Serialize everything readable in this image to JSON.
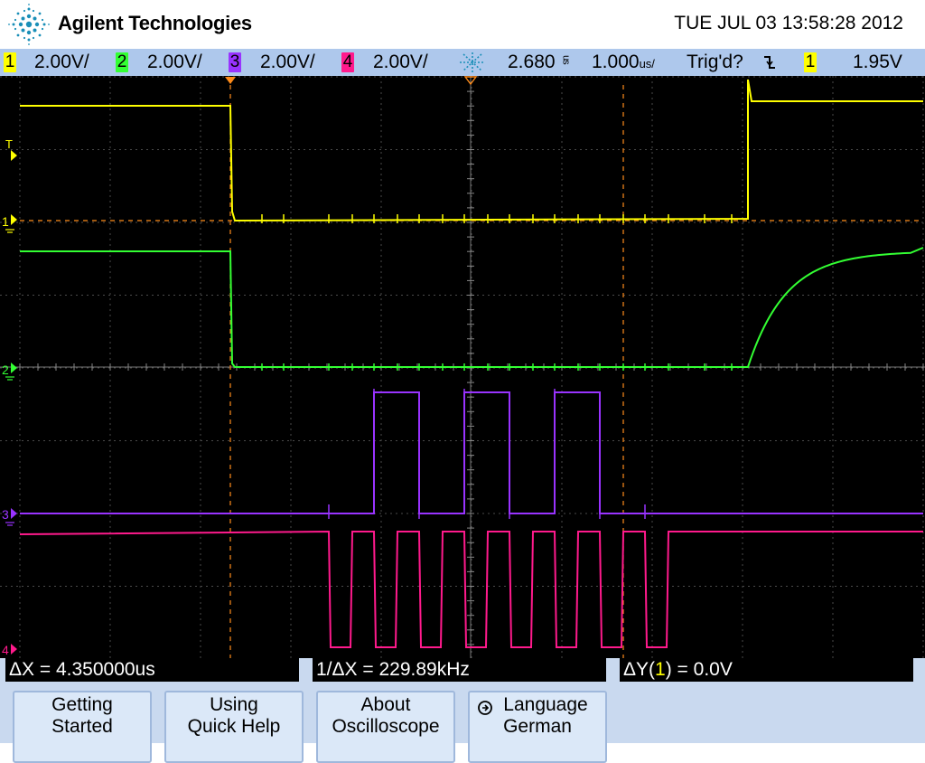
{
  "header": {
    "brand": "Agilent Technologies",
    "datetime": "TUE JUL 03 13:58:28 2012"
  },
  "status": {
    "channels": [
      {
        "num": "1",
        "scale": "2.00V/",
        "color": "#ffff00"
      },
      {
        "num": "2",
        "scale": "2.00V/",
        "color": "#33ff33"
      },
      {
        "num": "3",
        "scale": "2.00V/",
        "color": "#9933ff"
      },
      {
        "num": "4",
        "scale": "2.00V/",
        "color": "#ff1a8c"
      }
    ],
    "time_position": "2.680",
    "time_position_unit": "us",
    "time_scale": "1.000",
    "time_scale_unit": "us/",
    "trigger_status": "Trig'd?",
    "trigger_slope_icon": "falling-edge-icon",
    "trigger_source": "1",
    "trigger_level": "1.95V"
  },
  "markers": {
    "ch1": "1",
    "ch2": "2",
    "ch3": "3",
    "ch4": "4",
    "trigger": "T"
  },
  "measurements": {
    "delta_x": "ΔX = 4.350000us",
    "inv_delta_x": "1/ΔX = 229.89kHz",
    "delta_y_prefix": "ΔY(",
    "delta_y_channel": "1",
    "delta_y_suffix": ") = 0.0V"
  },
  "softkeys": [
    {
      "line1": "Getting",
      "line2": "Started"
    },
    {
      "line1": "Using",
      "line2": "Quick Help"
    },
    {
      "line1": "About",
      "line2": "Oscilloscope"
    },
    {
      "line1": "Language",
      "line2": "German"
    }
  ],
  "colors": {
    "ch1": "#ffff00",
    "ch2": "#33ff33",
    "ch3": "#9933ff",
    "ch4": "#ff1a8c",
    "cursor": "#ff8c1a",
    "grid": "#555555",
    "status_bg": "#aec8ec"
  }
}
